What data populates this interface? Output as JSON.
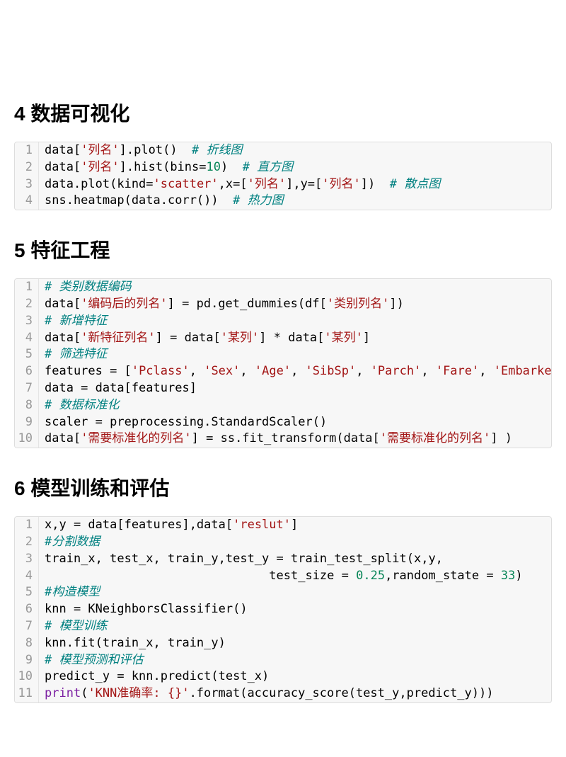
{
  "sections": [
    {
      "number": "4",
      "title": "数据可视化",
      "code": [
        [
          {
            "t": "data[",
            "c": ""
          },
          {
            "t": "'列名'",
            "c": "s-str"
          },
          {
            "t": "].plot()  ",
            "c": ""
          },
          {
            "t": "# 折线图",
            "c": "s-cmt"
          }
        ],
        [
          {
            "t": "data[",
            "c": ""
          },
          {
            "t": "'列名'",
            "c": "s-str"
          },
          {
            "t": "].hist(bins=",
            "c": ""
          },
          {
            "t": "10",
            "c": "s-num"
          },
          {
            "t": ")  ",
            "c": ""
          },
          {
            "t": "# 直方图",
            "c": "s-cmt"
          }
        ],
        [
          {
            "t": "data.plot(kind=",
            "c": ""
          },
          {
            "t": "'scatter'",
            "c": "s-str"
          },
          {
            "t": ",x=[",
            "c": ""
          },
          {
            "t": "'列名'",
            "c": "s-str"
          },
          {
            "t": "],y=[",
            "c": ""
          },
          {
            "t": "'列名'",
            "c": "s-str"
          },
          {
            "t": "])  ",
            "c": ""
          },
          {
            "t": "# 散点图",
            "c": "s-cmt"
          }
        ],
        [
          {
            "t": "sns.heatmap(data.corr())  ",
            "c": ""
          },
          {
            "t": "# 热力图",
            "c": "s-cmt"
          }
        ]
      ]
    },
    {
      "number": "5",
      "title": "特征工程",
      "code": [
        [
          {
            "t": "# 类别数据编码",
            "c": "s-cmt"
          }
        ],
        [
          {
            "t": "data[",
            "c": ""
          },
          {
            "t": "'编码后的列名'",
            "c": "s-str"
          },
          {
            "t": "] = pd.get_dummies(df[",
            "c": ""
          },
          {
            "t": "'类别列名'",
            "c": "s-str"
          },
          {
            "t": "])",
            "c": ""
          }
        ],
        [
          {
            "t": "# 新增特征",
            "c": "s-cmt"
          }
        ],
        [
          {
            "t": "data[",
            "c": ""
          },
          {
            "t": "'新特征列名'",
            "c": "s-str"
          },
          {
            "t": "] = data[",
            "c": ""
          },
          {
            "t": "'某列'",
            "c": "s-str"
          },
          {
            "t": "] * data[",
            "c": ""
          },
          {
            "t": "'某列'",
            "c": "s-str"
          },
          {
            "t": "]",
            "c": ""
          }
        ],
        [
          {
            "t": "# 筛选特征",
            "c": "s-cmt"
          }
        ],
        [
          {
            "t": "features = [",
            "c": ""
          },
          {
            "t": "'Pclass'",
            "c": "s-str"
          },
          {
            "t": ", ",
            "c": ""
          },
          {
            "t": "'Sex'",
            "c": "s-str"
          },
          {
            "t": ", ",
            "c": ""
          },
          {
            "t": "'Age'",
            "c": "s-str"
          },
          {
            "t": ", ",
            "c": ""
          },
          {
            "t": "'SibSp'",
            "c": "s-str"
          },
          {
            "t": ", ",
            "c": ""
          },
          {
            "t": "'Parch'",
            "c": "s-str"
          },
          {
            "t": ", ",
            "c": ""
          },
          {
            "t": "'Fare'",
            "c": "s-str"
          },
          {
            "t": ", ",
            "c": ""
          },
          {
            "t": "'Embarked",
            "c": "s-str"
          }
        ],
        [
          {
            "t": "data = data[features]",
            "c": ""
          }
        ],
        [
          {
            "t": "# 数据标准化",
            "c": "s-cmt"
          }
        ],
        [
          {
            "t": "scaler = preprocessing.StandardScaler()",
            "c": ""
          }
        ],
        [
          {
            "t": "data[",
            "c": ""
          },
          {
            "t": "'需要标准化的列名'",
            "c": "s-str"
          },
          {
            "t": "] = ss.fit_transform(data[",
            "c": ""
          },
          {
            "t": "'需要标准化的列名'",
            "c": "s-str"
          },
          {
            "t": "] )",
            "c": ""
          }
        ]
      ]
    },
    {
      "number": "6",
      "title": "模型训练和评估",
      "code": [
        [
          {
            "t": "x,y = data[features],data[",
            "c": ""
          },
          {
            "t": "'reslut'",
            "c": "s-str"
          },
          {
            "t": "]",
            "c": ""
          }
        ],
        [
          {
            "t": "#分割数据",
            "c": "s-cmt"
          }
        ],
        [
          {
            "t": "train_x, test_x, train_y,test_y = train_test_split(x,y,",
            "c": ""
          }
        ],
        [
          {
            "t": "                               test_size = ",
            "c": ""
          },
          {
            "t": "0.25",
            "c": "s-num"
          },
          {
            "t": ",random_state = ",
            "c": ""
          },
          {
            "t": "33",
            "c": "s-num"
          },
          {
            "t": ")",
            "c": ""
          }
        ],
        [
          {
            "t": "#构造模型",
            "c": "s-cmt"
          }
        ],
        [
          {
            "t": "knn = KNeighborsClassifier()",
            "c": ""
          }
        ],
        [
          {
            "t": "# 模型训练",
            "c": "s-cmt"
          }
        ],
        [
          {
            "t": "knn.fit(train_x, train_y)",
            "c": ""
          }
        ],
        [
          {
            "t": "# 模型预测和评估",
            "c": "s-cmt"
          }
        ],
        [
          {
            "t": "predict_y = knn.predict(test_x)",
            "c": ""
          }
        ],
        [
          {
            "t": "print",
            "c": "s-kw"
          },
          {
            "t": "(",
            "c": ""
          },
          {
            "t": "'KNN准确率: {}'",
            "c": "s-str"
          },
          {
            "t": ".format(accuracy_score(test_y,predict_y)))",
            "c": ""
          }
        ]
      ]
    }
  ]
}
